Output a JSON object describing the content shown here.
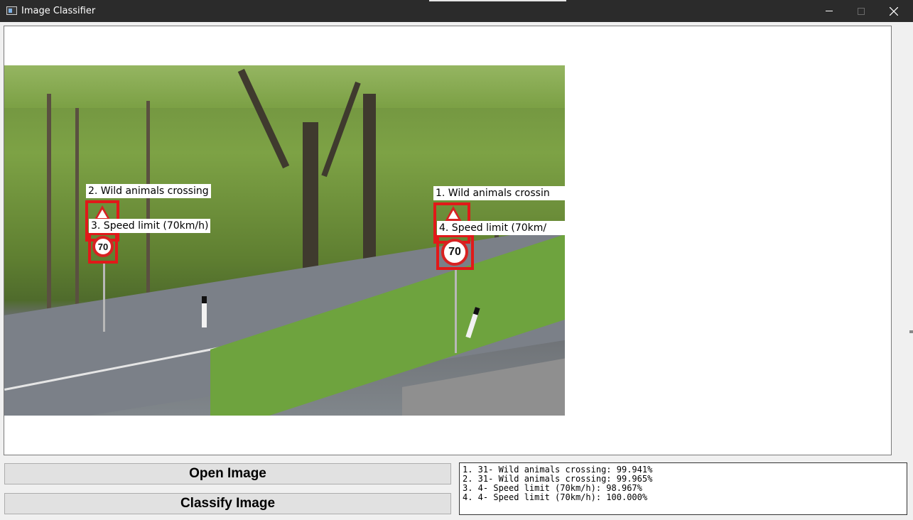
{
  "window": {
    "title": "Image Classifier",
    "icon": "app-window-icon",
    "controls": [
      "minimize-icon",
      "maximize-icon",
      "close-icon"
    ]
  },
  "image": {
    "description_icon": "road-scene-photo",
    "detections": [
      {
        "label": "1. Wild animals crossin",
        "color": "#e11919"
      },
      {
        "label": "2. Wild animals crossing",
        "color": "#e11919"
      },
      {
        "label": "3. Speed limit (70km/h)",
        "color": "#e11919"
      },
      {
        "label": "4. Speed limit (70km/",
        "color": "#e11919"
      }
    ],
    "sign_text": "70"
  },
  "buttons": {
    "open_label": "Open Image",
    "classify_label": "Classify Image"
  },
  "results": {
    "lines": [
      "1. 31- Wild animals crossing: 99.941%",
      "2. 31- Wild animals crossing: 99.965%",
      "3. 4- Speed limit (70km/h): 98.967%",
      "4. 4- Speed limit (70km/h): 100.000%"
    ]
  }
}
